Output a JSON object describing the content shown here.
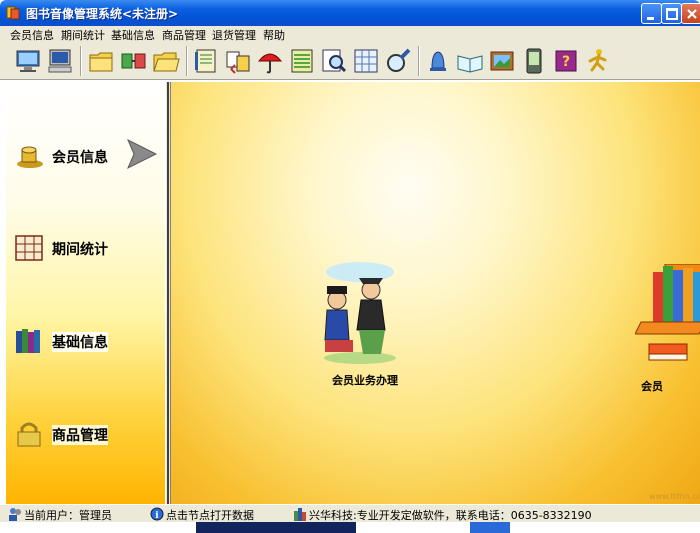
{
  "window": {
    "title": "图书音像管理系统<未注册>",
    "icons": {
      "app": "app-icon",
      "minimize": "minimize-icon",
      "maximize": "maximize-icon",
      "close": "close-icon"
    }
  },
  "menu": {
    "items": [
      {
        "label": "会员信息"
      },
      {
        "label": "期间统计"
      },
      {
        "label": "基础信息"
      },
      {
        "label": "商品管理"
      },
      {
        "label": "退货管理"
      },
      {
        "label": "帮助"
      }
    ]
  },
  "toolbar": {
    "buttons": [
      {
        "icon": "computer-monitor-icon"
      },
      {
        "icon": "computer-icon"
      },
      {
        "icon": "folder-icon"
      },
      {
        "icon": "network-folder-icon"
      },
      {
        "icon": "folder-open-icon"
      },
      {
        "icon": "notebook-icon"
      },
      {
        "icon": "transfer-icon"
      },
      {
        "icon": "umbrella-icon"
      },
      {
        "icon": "ledger-icon"
      },
      {
        "icon": "magnifier-document-icon"
      },
      {
        "icon": "grid-icon"
      },
      {
        "icon": "search-lens-icon"
      },
      {
        "icon": "bell-icon"
      },
      {
        "icon": "open-book-icon"
      },
      {
        "icon": "picture-icon"
      },
      {
        "icon": "pda-icon"
      },
      {
        "icon": "help-book-icon"
      },
      {
        "icon": "exit-runner-icon"
      }
    ]
  },
  "sidebar": {
    "items": [
      {
        "label": "会员信息",
        "icon": "members-icon"
      },
      {
        "label": "期间统计",
        "icon": "grid-icon"
      },
      {
        "label": "基础信息",
        "icon": "books-icon"
      },
      {
        "label": "商品管理",
        "icon": "padlock-icon"
      }
    ],
    "arrow_icon": "arrow-right-icon"
  },
  "main": {
    "items": [
      {
        "label": "会员业务办理",
        "icon": "people-icon"
      },
      {
        "label": "会员",
        "icon": "books-stack-icon"
      }
    ],
    "watermark": "www.ttfnn.com"
  },
  "status": {
    "user": "当前用户：管理员",
    "hint": "点击节点打开数据",
    "company": "兴华科技:专业开发定做软件，联系电话：0635-8332190",
    "icons": {
      "user": "users-icon",
      "hint": "info-icon",
      "company": "company-icon"
    }
  },
  "colors": {
    "titlebar": "#0453d6",
    "chrome": "#ece9d8",
    "sidebar_bottom": "#ffb400",
    "main_warm": "#f8c030"
  }
}
